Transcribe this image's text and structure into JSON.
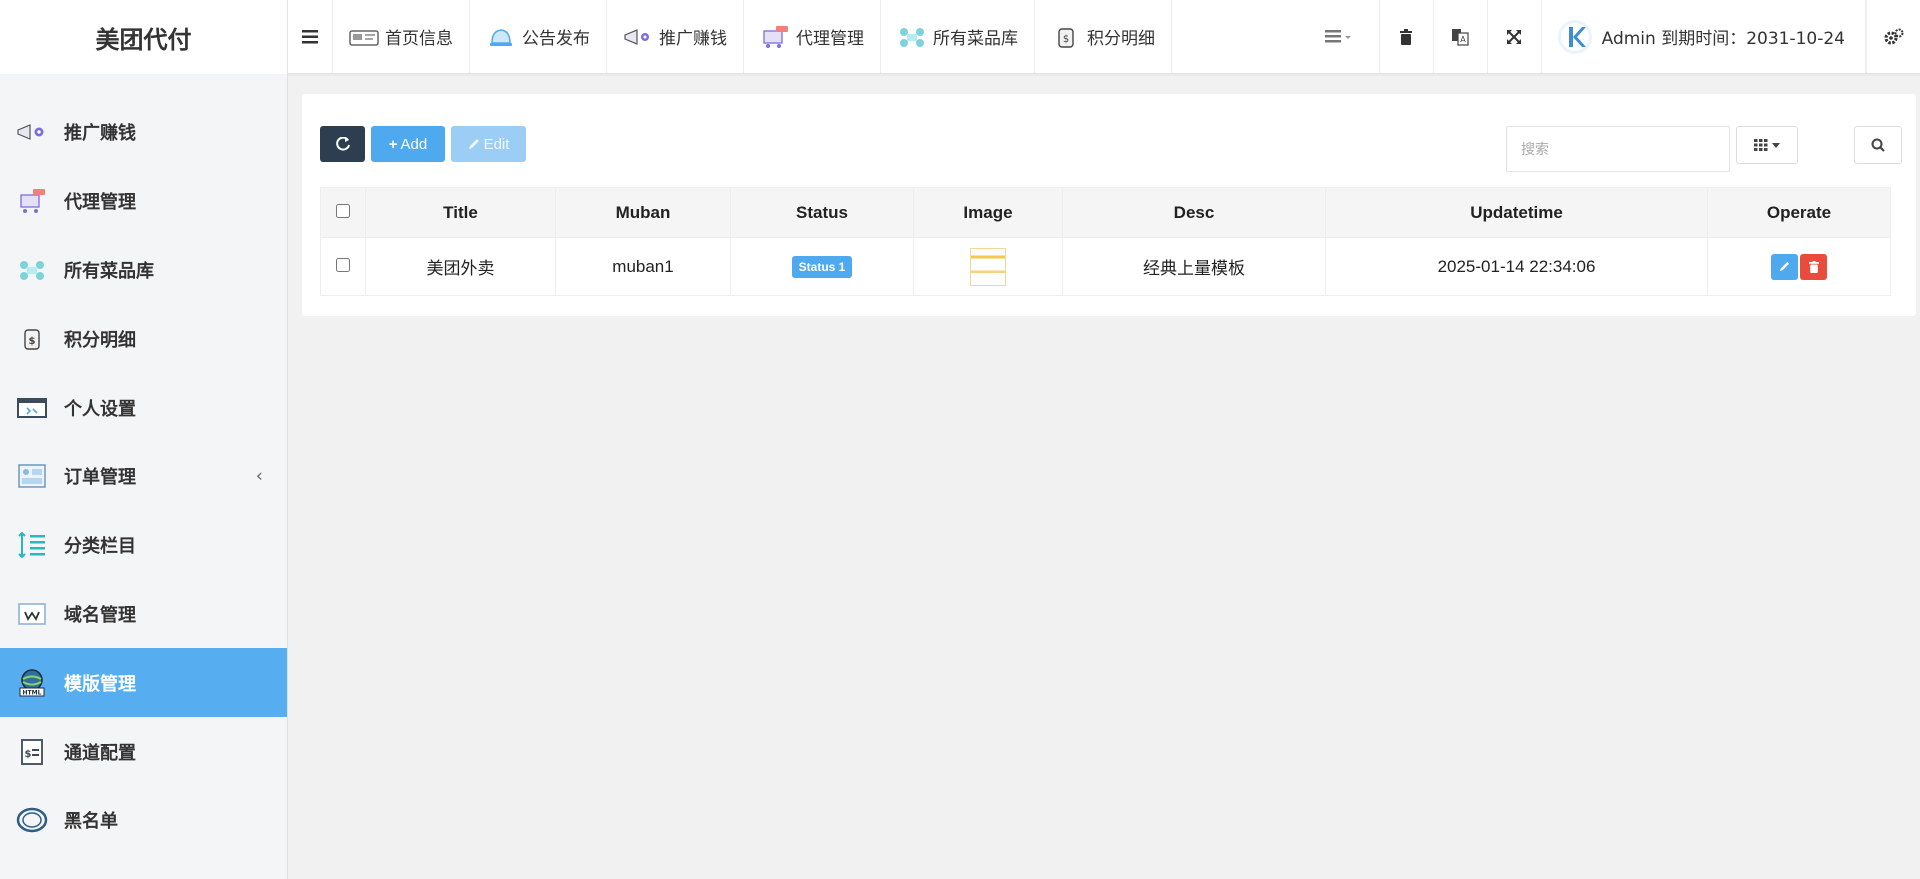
{
  "brand": {
    "title": "美团代付"
  },
  "topnav": {
    "items": [
      {
        "label": "首页信息",
        "icon": "dashboard-icon"
      },
      {
        "label": "公告发布",
        "icon": "bell-icon"
      },
      {
        "label": "推广赚钱",
        "icon": "megaphone-icon"
      },
      {
        "label": "代理管理",
        "icon": "cart-icon"
      },
      {
        "label": "所有菜品库",
        "icon": "network-icon"
      },
      {
        "label": "积分明细",
        "icon": "clipboard-dollar-icon"
      }
    ],
    "user_label": "Admin 到期时间：2031-10-24"
  },
  "sidebar": {
    "items": [
      {
        "label": "推广赚钱",
        "icon": "megaphone-icon"
      },
      {
        "label": "代理管理",
        "icon": "cart-icon"
      },
      {
        "label": "所有菜品库",
        "icon": "network-icon"
      },
      {
        "label": "积分明细",
        "icon": "clipboard-dollar-icon"
      },
      {
        "label": "个人设置",
        "icon": "window-icon"
      },
      {
        "label": "订单管理",
        "icon": "gallery-icon",
        "arrow": "‹"
      },
      {
        "label": "分类栏目",
        "icon": "line-height-icon"
      },
      {
        "label": "域名管理",
        "icon": "domain-icon"
      },
      {
        "label": "模版管理",
        "icon": "html-globe-icon",
        "active": true
      },
      {
        "label": "通道配置",
        "icon": "payment-doc-icon"
      },
      {
        "label": "黑名单",
        "icon": "ring-icon"
      }
    ]
  },
  "toolbar": {
    "add_label": "Add",
    "edit_label": "Edit",
    "search_placeholder": "搜索"
  },
  "table": {
    "columns": [
      "Title",
      "Muban",
      "Status",
      "Image",
      "Desc",
      "Updatetime",
      "Operate"
    ],
    "rows": [
      {
        "title": "美团外卖",
        "muban": "muban1",
        "status": "Status 1",
        "desc": "经典上量模板",
        "updatetime": "2025-01-14 22:34:06"
      }
    ]
  },
  "colors": {
    "accent": "#56aef0",
    "dark_button": "#2c3e50",
    "danger": "#e74c3c"
  }
}
